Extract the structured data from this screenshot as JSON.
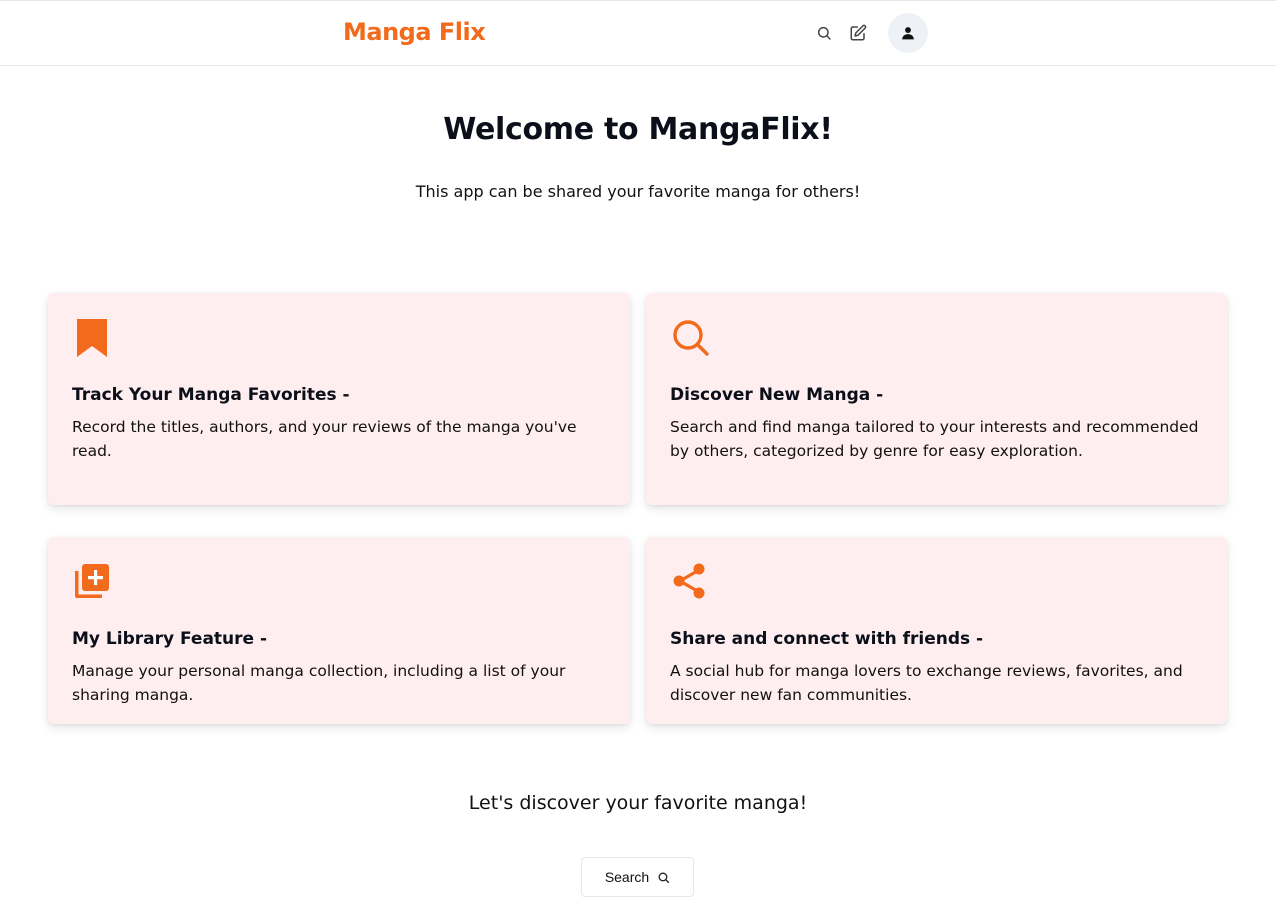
{
  "header": {
    "brand": "Manga Flix",
    "icons": [
      "search-icon",
      "edit-icon",
      "user-icon"
    ]
  },
  "hero": {
    "title": "Welcome to MangaFlix!",
    "subtitle": "This app can be shared your favorite manga for others!"
  },
  "features": [
    {
      "icon": "bookmark-icon",
      "title": "Track Your Manga Favorites -",
      "text": "Record the titles, authors, and your reviews of the manga you've read."
    },
    {
      "icon": "search-icon",
      "title": "Discover New Manga -",
      "text": "Search and find manga tailored to your interests and recommended by others, categorized by genre for easy exploration."
    },
    {
      "icon": "library-add-icon",
      "title": "My Library Feature -",
      "text": "Manage your personal manga collection, including a list of your sharing manga."
    },
    {
      "icon": "share-icon",
      "title": "Share and connect with friends -",
      "text": "A social hub for manga lovers to exchange reviews, favorites, and discover new fan communities."
    }
  ],
  "cta": {
    "text": "Let's discover your favorite manga!",
    "button_label": "Search"
  },
  "colors": {
    "accent": "#f26a1b",
    "card_bg": "#ffeeef",
    "avatar_bg": "#eef1f6"
  }
}
